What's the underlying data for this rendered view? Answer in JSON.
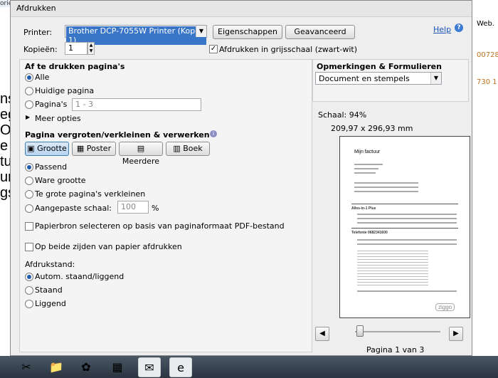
{
  "window": {
    "title": "Afdrukken"
  },
  "background": {
    "tab_fragment": "orie",
    "left_text": [
      "ns",
      "eg",
      "OC",
      "e",
      "tu",
      "un",
      "gs"
    ]
  },
  "printer": {
    "label": "Printer:",
    "value": "Brother DCP-7055W Printer (Kopie 1)",
    "properties_btn": "Eigenschappen",
    "advanced_btn": "Geavanceerd",
    "help_link": "Help",
    "copies_label": "Kopieën:",
    "copies_value": "1",
    "grayscale_label": "Afdrukken in grijsschaal (zwart-wit)",
    "grayscale_checked": true
  },
  "pages": {
    "heading": "Af te drukken pagina's",
    "all": "Alle",
    "current": "Huidige pagina",
    "range_label": "Pagina's",
    "range_value": "1 - 3",
    "more": "Meer opties"
  },
  "scaling": {
    "heading": "Pagina vergroten/verkleinen & verwerken",
    "tabs": [
      "Grootte",
      "Poster",
      "Meerdere",
      "Boek"
    ],
    "fit": "Passend",
    "actual": "Ware grootte",
    "shrink": "Te grote pagina's verkleinen",
    "custom": "Aangepaste schaal:",
    "custom_value": "100",
    "percent": "%",
    "paper_source": "Papierbron selecteren op basis van paginaformaat PDF-bestand"
  },
  "duplex": {
    "label": "Op beide zijden van papier afdrukken"
  },
  "orientation": {
    "heading": "Afdrukstand:",
    "auto": "Autom. staand/liggend",
    "portrait": "Staand",
    "landscape": "Liggend"
  },
  "comments": {
    "heading": "Opmerkingen & Formulieren",
    "value": "Document en stempels"
  },
  "preview": {
    "scale": "Schaal:  94%",
    "size": "209,97 x 296,93 mm",
    "doc_title": "Mijn factuur",
    "logo": "ziggo",
    "page_indicator": "Pagina 1 van 3",
    "sections": [
      "Alles-in-1 Plus",
      "Telefonie 0682341600"
    ]
  },
  "bg_right_text": [
    "Web.",
    "00728",
    "730 1"
  ],
  "colors": {
    "accent": "#3a76c7",
    "link": "#1a52b8"
  }
}
